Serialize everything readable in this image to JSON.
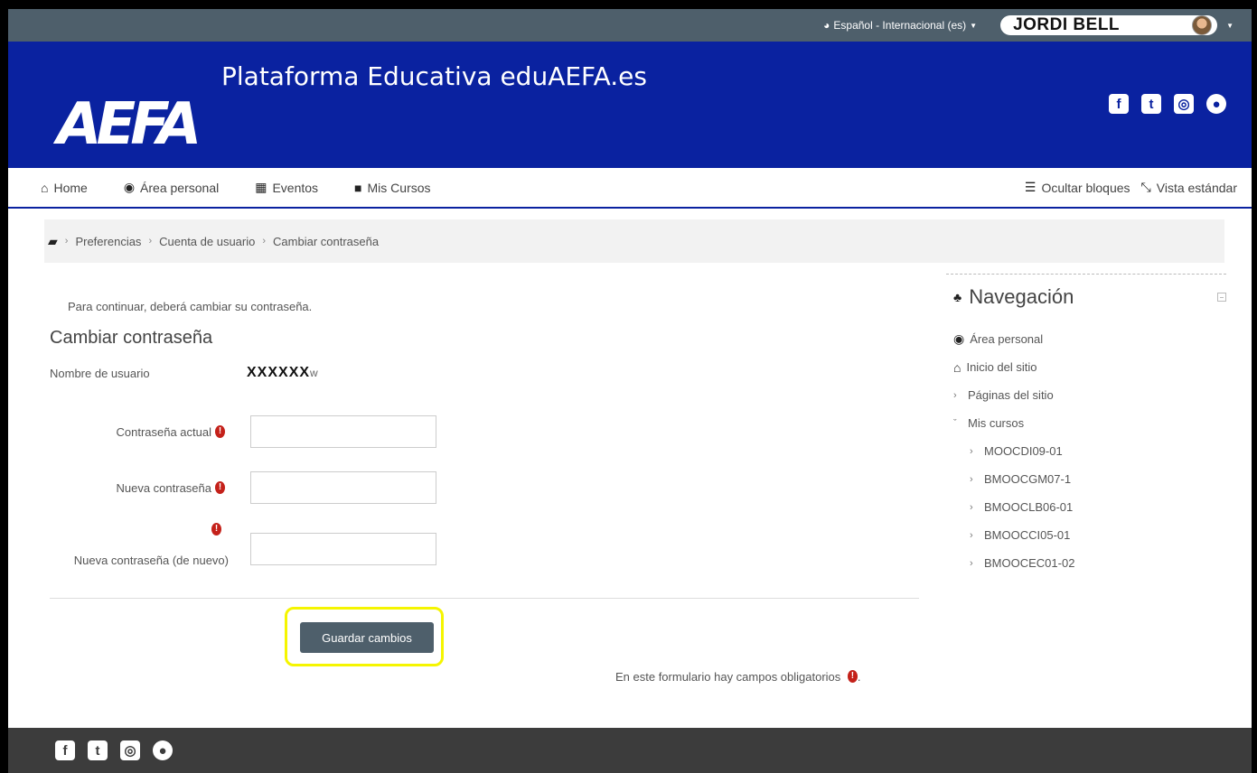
{
  "topbar": {
    "language": "Español - Internacional (es)",
    "user_name": "JORDI BELL"
  },
  "header": {
    "logo": "AEFA",
    "site_title": "Plataforma Educativa eduAEFA.es",
    "social_icons": [
      "facebook-icon",
      "twitter-icon",
      "instagram-icon",
      "globe-icon"
    ]
  },
  "nav": {
    "home": "Home",
    "area_personal": "Área personal",
    "eventos": "Eventos",
    "mis_cursos": "Mis Cursos",
    "ocultar_bloques": "Ocultar bloques",
    "vista_estandar": "Vista estándar"
  },
  "breadcrumb": {
    "items": [
      "Preferencias",
      "Cuenta de usuario",
      "Cambiar contraseña"
    ]
  },
  "form": {
    "notice": "Para continuar, deberá cambiar su contraseña.",
    "heading": "Cambiar contraseña",
    "username_label": "Nombre de usuario",
    "username_value": "XXXXXX",
    "username_suffix": "w",
    "current_password_label": "Contraseña actual",
    "new_password_label": "Nueva contraseña",
    "new_password_again_label": "Nueva contraseña (de nuevo)",
    "current_password_value": "",
    "new_password_value": "",
    "new_password_again_value": "",
    "submit_label": "Guardar cambios",
    "required_note": "En este formulario hay campos obligatorios",
    "required_note_suffix": "."
  },
  "sidebar": {
    "title": "Navegación",
    "items": {
      "area_personal": "Área personal",
      "inicio": "Inicio del sitio",
      "paginas": "Páginas del sitio",
      "mis_cursos": "Mis cursos",
      "courses": [
        "MOOCDI09-01",
        "BMOOCGM07-1",
        "BMOOCLB06-01",
        "BMOOCCI05-01",
        "BMOOCEC01-02"
      ]
    }
  },
  "colors": {
    "header_blue": "#0a22a0",
    "topbar": "#4e5f6b",
    "button": "#4e5f6b",
    "required": "#c4211a",
    "highlight": "#f5f500",
    "footer": "#3c3c3c"
  }
}
